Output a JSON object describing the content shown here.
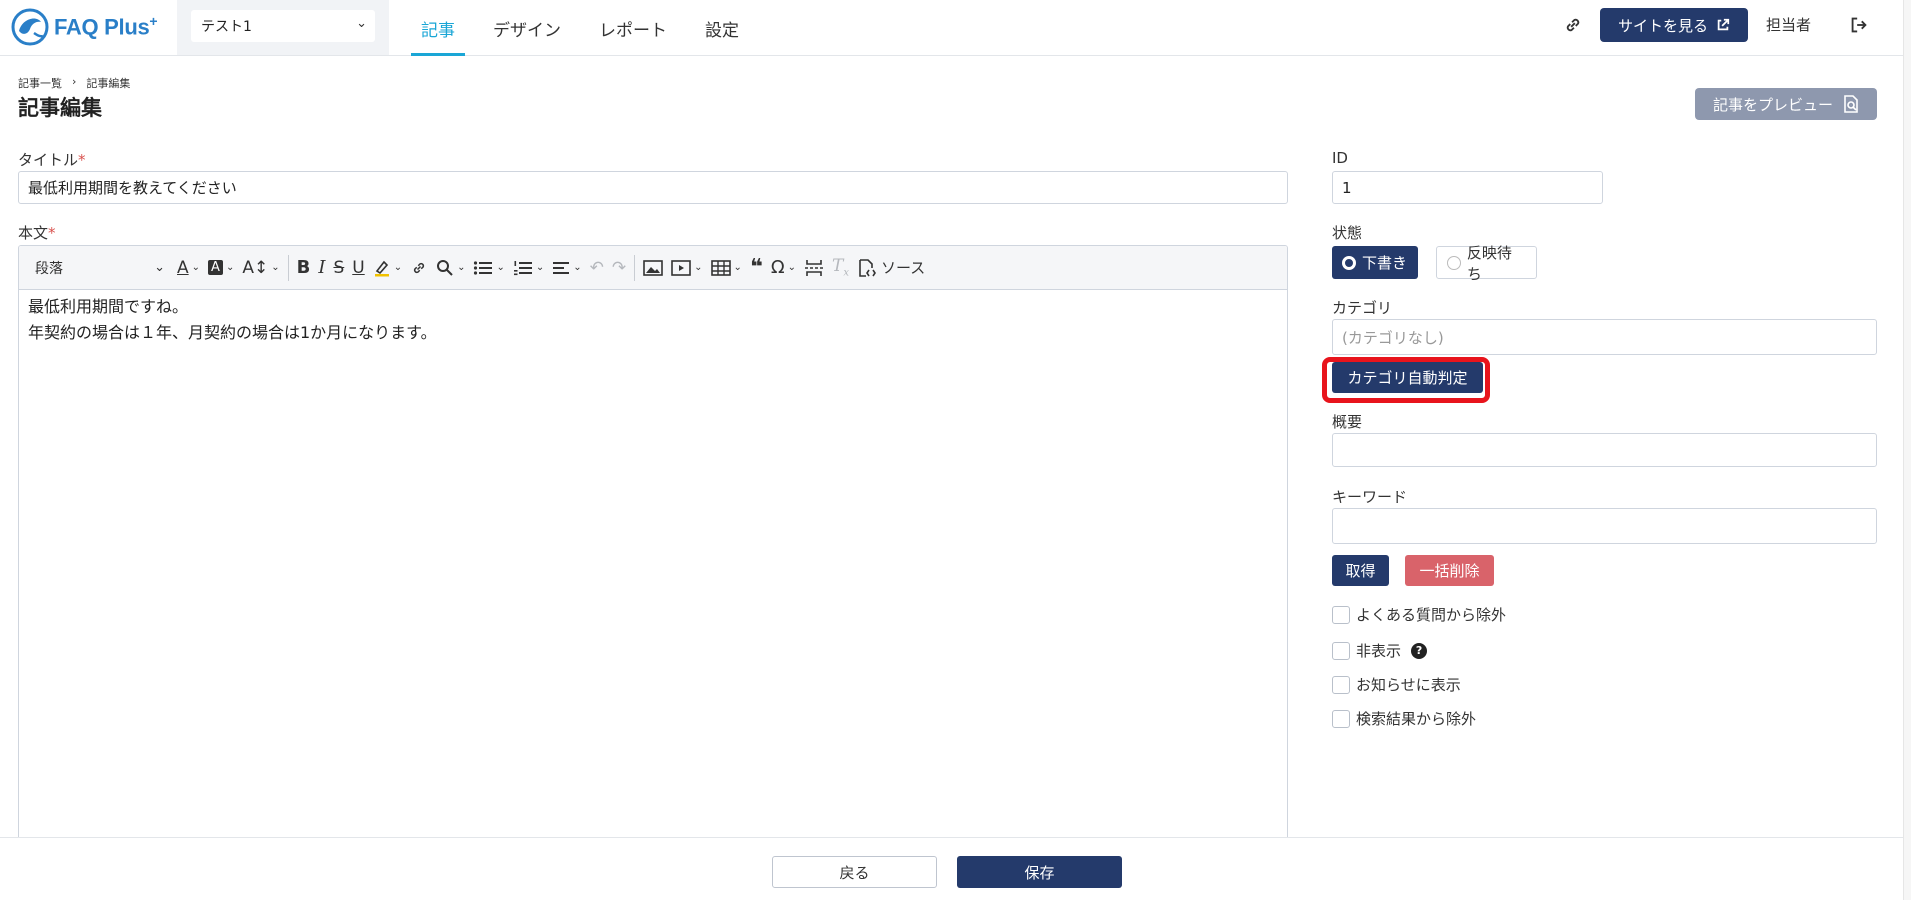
{
  "header": {
    "logo_text": "FAQ Plus",
    "logo_sup": "+",
    "site_select": {
      "value": "テスト1"
    },
    "nav": [
      {
        "label": "記事",
        "active": true
      },
      {
        "label": "デザイン",
        "active": false
      },
      {
        "label": "レポート",
        "active": false
      },
      {
        "label": "設定",
        "active": false
      }
    ],
    "view_site_label": "サイトを見る",
    "user_label": "担当者"
  },
  "breadcrumb": [
    "記事一覧",
    "›",
    "記事編集"
  ],
  "page_title": "記事編集",
  "preview_label": "記事をプレビュー",
  "form": {
    "title": {
      "label": "タイトル",
      "required_mark": "*",
      "value": "最低利用期間を教えてください"
    },
    "body": {
      "label": "本文",
      "required_mark": "*",
      "heading_select": "段落",
      "source_label": "ソース",
      "lines": [
        "最低利用期間ですね。",
        "年契約の場合は１年、月契約の場合は1か月になります。"
      ]
    }
  },
  "sidebar": {
    "id": {
      "label": "ID",
      "value": "1"
    },
    "state": {
      "label": "状態",
      "options": [
        "下書き",
        "反映待ち"
      ],
      "selected": "下書き"
    },
    "category": {
      "label": "カテゴリ",
      "placeholder": "(カテゴリなし)",
      "auto_button": "カテゴリ自動判定"
    },
    "summary": {
      "label": "概要",
      "value": ""
    },
    "keyword": {
      "label": "キーワード",
      "value": "",
      "fetch_button": "取得",
      "clear_button": "一括削除"
    },
    "checks": [
      {
        "label": "よくある質問から除外",
        "checked": false
      },
      {
        "label": "非表示",
        "checked": false,
        "help": "?"
      },
      {
        "label": "お知らせに表示",
        "checked": false
      },
      {
        "label": "検索結果から除外",
        "checked": false
      }
    ]
  },
  "footer": {
    "back_label": "戻る",
    "save_label": "保存"
  },
  "colors": {
    "primary": "#243a6b",
    "accent": "#1aa6d6",
    "danger": "#d9636a",
    "highlight_border": "#e8141c"
  }
}
